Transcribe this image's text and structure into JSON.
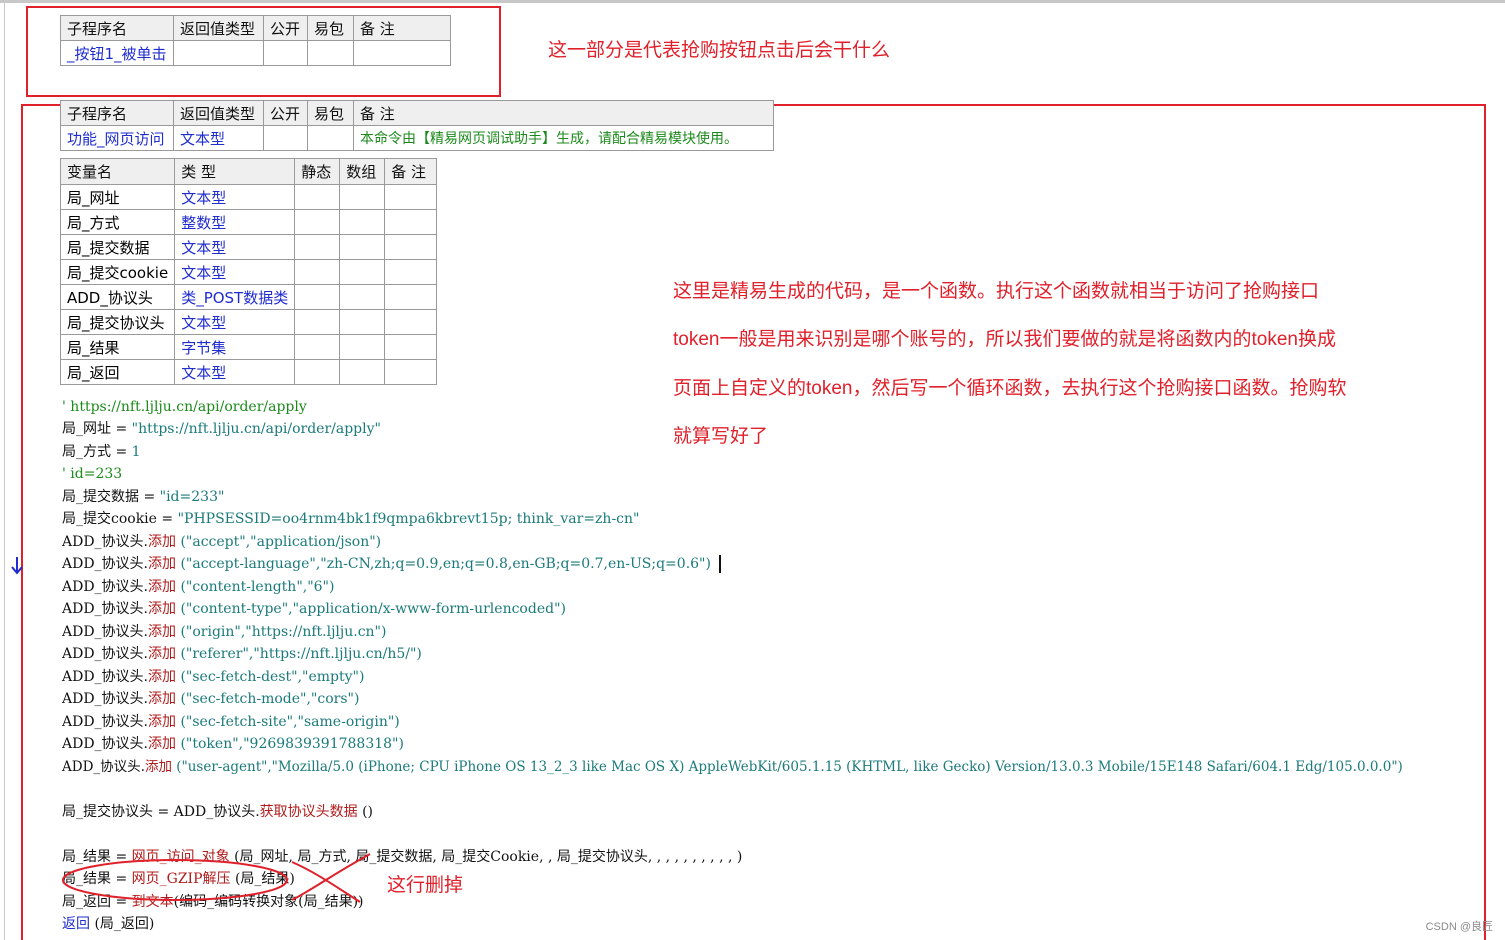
{
  "table1": {
    "headers": [
      "子程序名",
      "返回值类型",
      "公开",
      "易包",
      "备 注"
    ],
    "row": [
      "_按钮1_被单击",
      "",
      "",
      "",
      ""
    ]
  },
  "table2": {
    "headers": [
      "子程序名",
      "返回值类型",
      "公开",
      "易包",
      "备 注"
    ],
    "row": [
      "功能_网页访问",
      "文本型",
      "",
      "",
      "本命令由【精易网页调试助手】生成，请配合精易模块使用。"
    ]
  },
  "vars": {
    "headers": [
      "变量名",
      "类 型",
      "静态",
      "数组",
      "备 注"
    ],
    "rows": [
      {
        "name": "局_网址",
        "type": "文本型"
      },
      {
        "name": "局_方式",
        "type": "整数型"
      },
      {
        "name": "局_提交数据",
        "type": "文本型"
      },
      {
        "name": "局_提交cookie",
        "type": "文本型"
      },
      {
        "name": "ADD_协议头",
        "type": "类_POST数据类"
      },
      {
        "name": "局_提交协议头",
        "type": "文本型"
      },
      {
        "name": "局_结果",
        "type": "字节集"
      },
      {
        "name": "局_返回",
        "type": "文本型"
      }
    ]
  },
  "code": {
    "l1": "' https://nft.ljlju.cn/api/order/apply",
    "l2a": "局_网址 = ",
    "l2b": "\"https://nft.ljlju.cn/api/order/apply\"",
    "l3a": "局_方式 = ",
    "l3b": "1",
    "l4": "' id=233",
    "l5a": "局_提交数据 = ",
    "l5b": "\"id=233\"",
    "l6a": "局_提交cookie = ",
    "l6b": "\"PHPSESSID=oo4rnm4bk1f9qmpa6kbrevt15p; think_var=zh-cn\"",
    "obj": "ADD_协议头.",
    "add": "添加",
    "h1": " (\"accept\",\"application/json\")",
    "h2": " (\"accept-language\",\"zh-CN,zh;q=0.9,en;q=0.8,en-GB;q=0.7,en-US;q=0.6\")",
    "h3": " (\"content-length\",\"6\")",
    "h4": " (\"content-type\",\"application/x-www-form-urlencoded\")",
    "h5": " (\"origin\",\"https://nft.ljlju.cn\")",
    "h6": " (\"referer\",\"https://nft.ljlju.cn/h5/\")",
    "h7": " (\"sec-fetch-dest\",\"empty\")",
    "h8": " (\"sec-fetch-mode\",\"cors\")",
    "h9": " (\"sec-fetch-site\",\"same-origin\")",
    "h10": " (\"token\",\"9269839391788318\")",
    "h11": " (\"user-agent\",\"Mozilla/5.0 (iPhone; CPU iPhone OS 13_2_3 like Mac OS X) AppleWebKit/605.1.15 (KHTML, like Gecko) Version/13.0.3 Mobile/15E148 Safari/604.1 Edg/105.0.0.0\")",
    "l18a": "局_提交协议头 = ADD_协议头.",
    "l18b": "获取协议头数据",
    "l18c": " ()",
    "l19a": "局_结果 = ",
    "l19b": "网页_访问_对象",
    "l19c": " (局_网址, 局_方式, 局_提交数据, 局_提交Cookie, , 局_提交协议头, , , , , , , , , , )",
    "l20a": "局_结果 = ",
    "l20b": "网页_GZIP解压",
    "l20c": " (局_结果)",
    "l21a": "局_返回 = ",
    "l21b": "到文本",
    "l21c": "(编码_编码转换对象(局_结果))",
    "l22a": "返回",
    "l22b": " (局_返回)"
  },
  "notes": {
    "n1": "这一部分是代表抢购按钮点击后会干什么",
    "n2": "这里是精易生成的代码，是一个函数。执行这个函数就相当于访问了抢购接口",
    "n3": "token一般是用来识别是哪个账号的，所以我们要做的就是将函数内的token换成",
    "n4": "页面上自定义的token，然后写一个循环函数，去执行这个抢购接口函数。抢购软",
    "n5": "就算写好了",
    "n6": "这行删掉"
  },
  "watermark": "CSDN @良匠"
}
